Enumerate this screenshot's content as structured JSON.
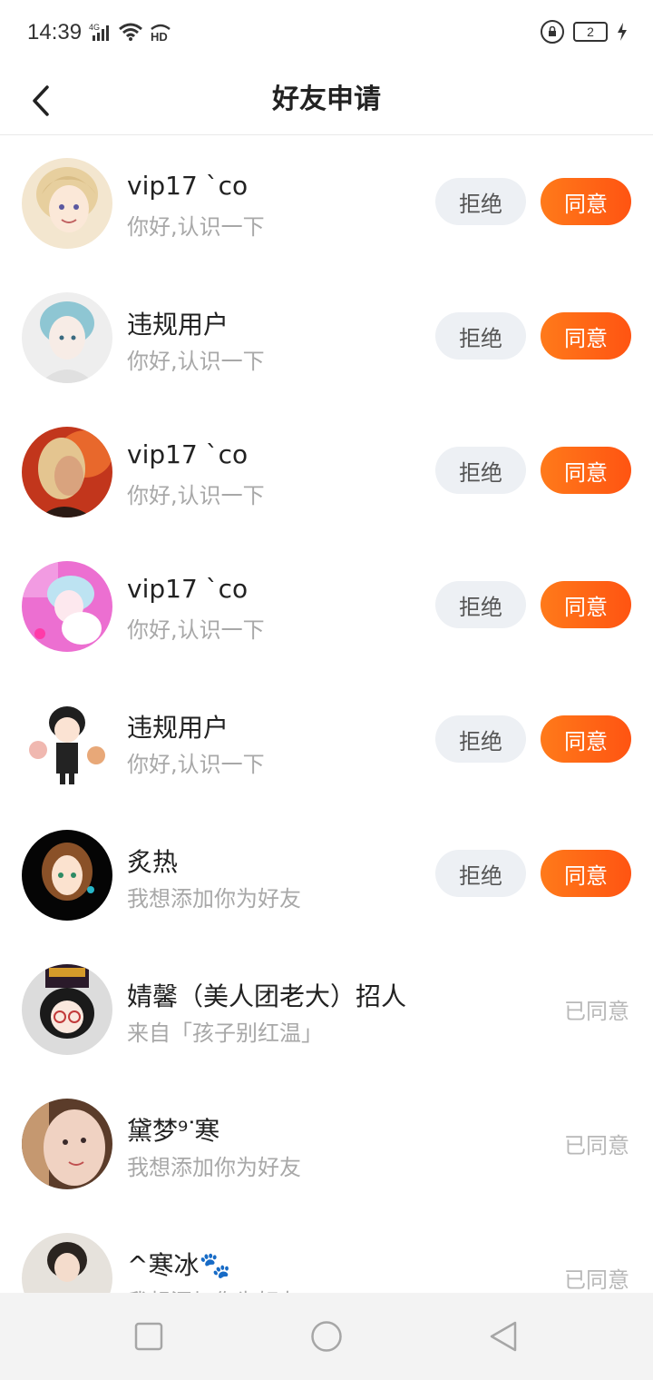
{
  "status": {
    "time": "14:39",
    "net": "4G",
    "hd": "HD",
    "battery_level": "2"
  },
  "header": {
    "title": "好友申请"
  },
  "actions": {
    "reject": "拒绝",
    "agree": "同意",
    "agreed": "已同意"
  },
  "colors": {
    "agree_button": "#ff5e16",
    "reject_button": "#edf0f4",
    "secondary_text": "#a8a8a8"
  },
  "requests": [
    {
      "name": "vip17 `co",
      "message": "你好,认识一下",
      "status": "pending"
    },
    {
      "name": "违规用户",
      "message": "你好,认识一下",
      "status": "pending"
    },
    {
      "name": "vip17 `co",
      "message": "你好,认识一下",
      "status": "pending"
    },
    {
      "name": "vip17 `co",
      "message": "你好,认识一下",
      "status": "pending"
    },
    {
      "name": "违规用户",
      "message": "你好,认识一下",
      "status": "pending"
    },
    {
      "name": "炙热",
      "message": "我想添加你为好友",
      "status": "pending"
    },
    {
      "name": "婧馨（美人团老大）招人",
      "message": "来自「孩子别红温」",
      "status": "agreed"
    },
    {
      "name": "黛梦⁹ᐝ寒",
      "message": "我想添加你为好友",
      "status": "agreed"
    },
    {
      "name": "^寒冰🐾",
      "message": "我想添加你为好友",
      "status": "agreed"
    }
  ],
  "navbar": {
    "icons": [
      "square-icon",
      "circle-icon",
      "triangle-back-icon"
    ]
  }
}
